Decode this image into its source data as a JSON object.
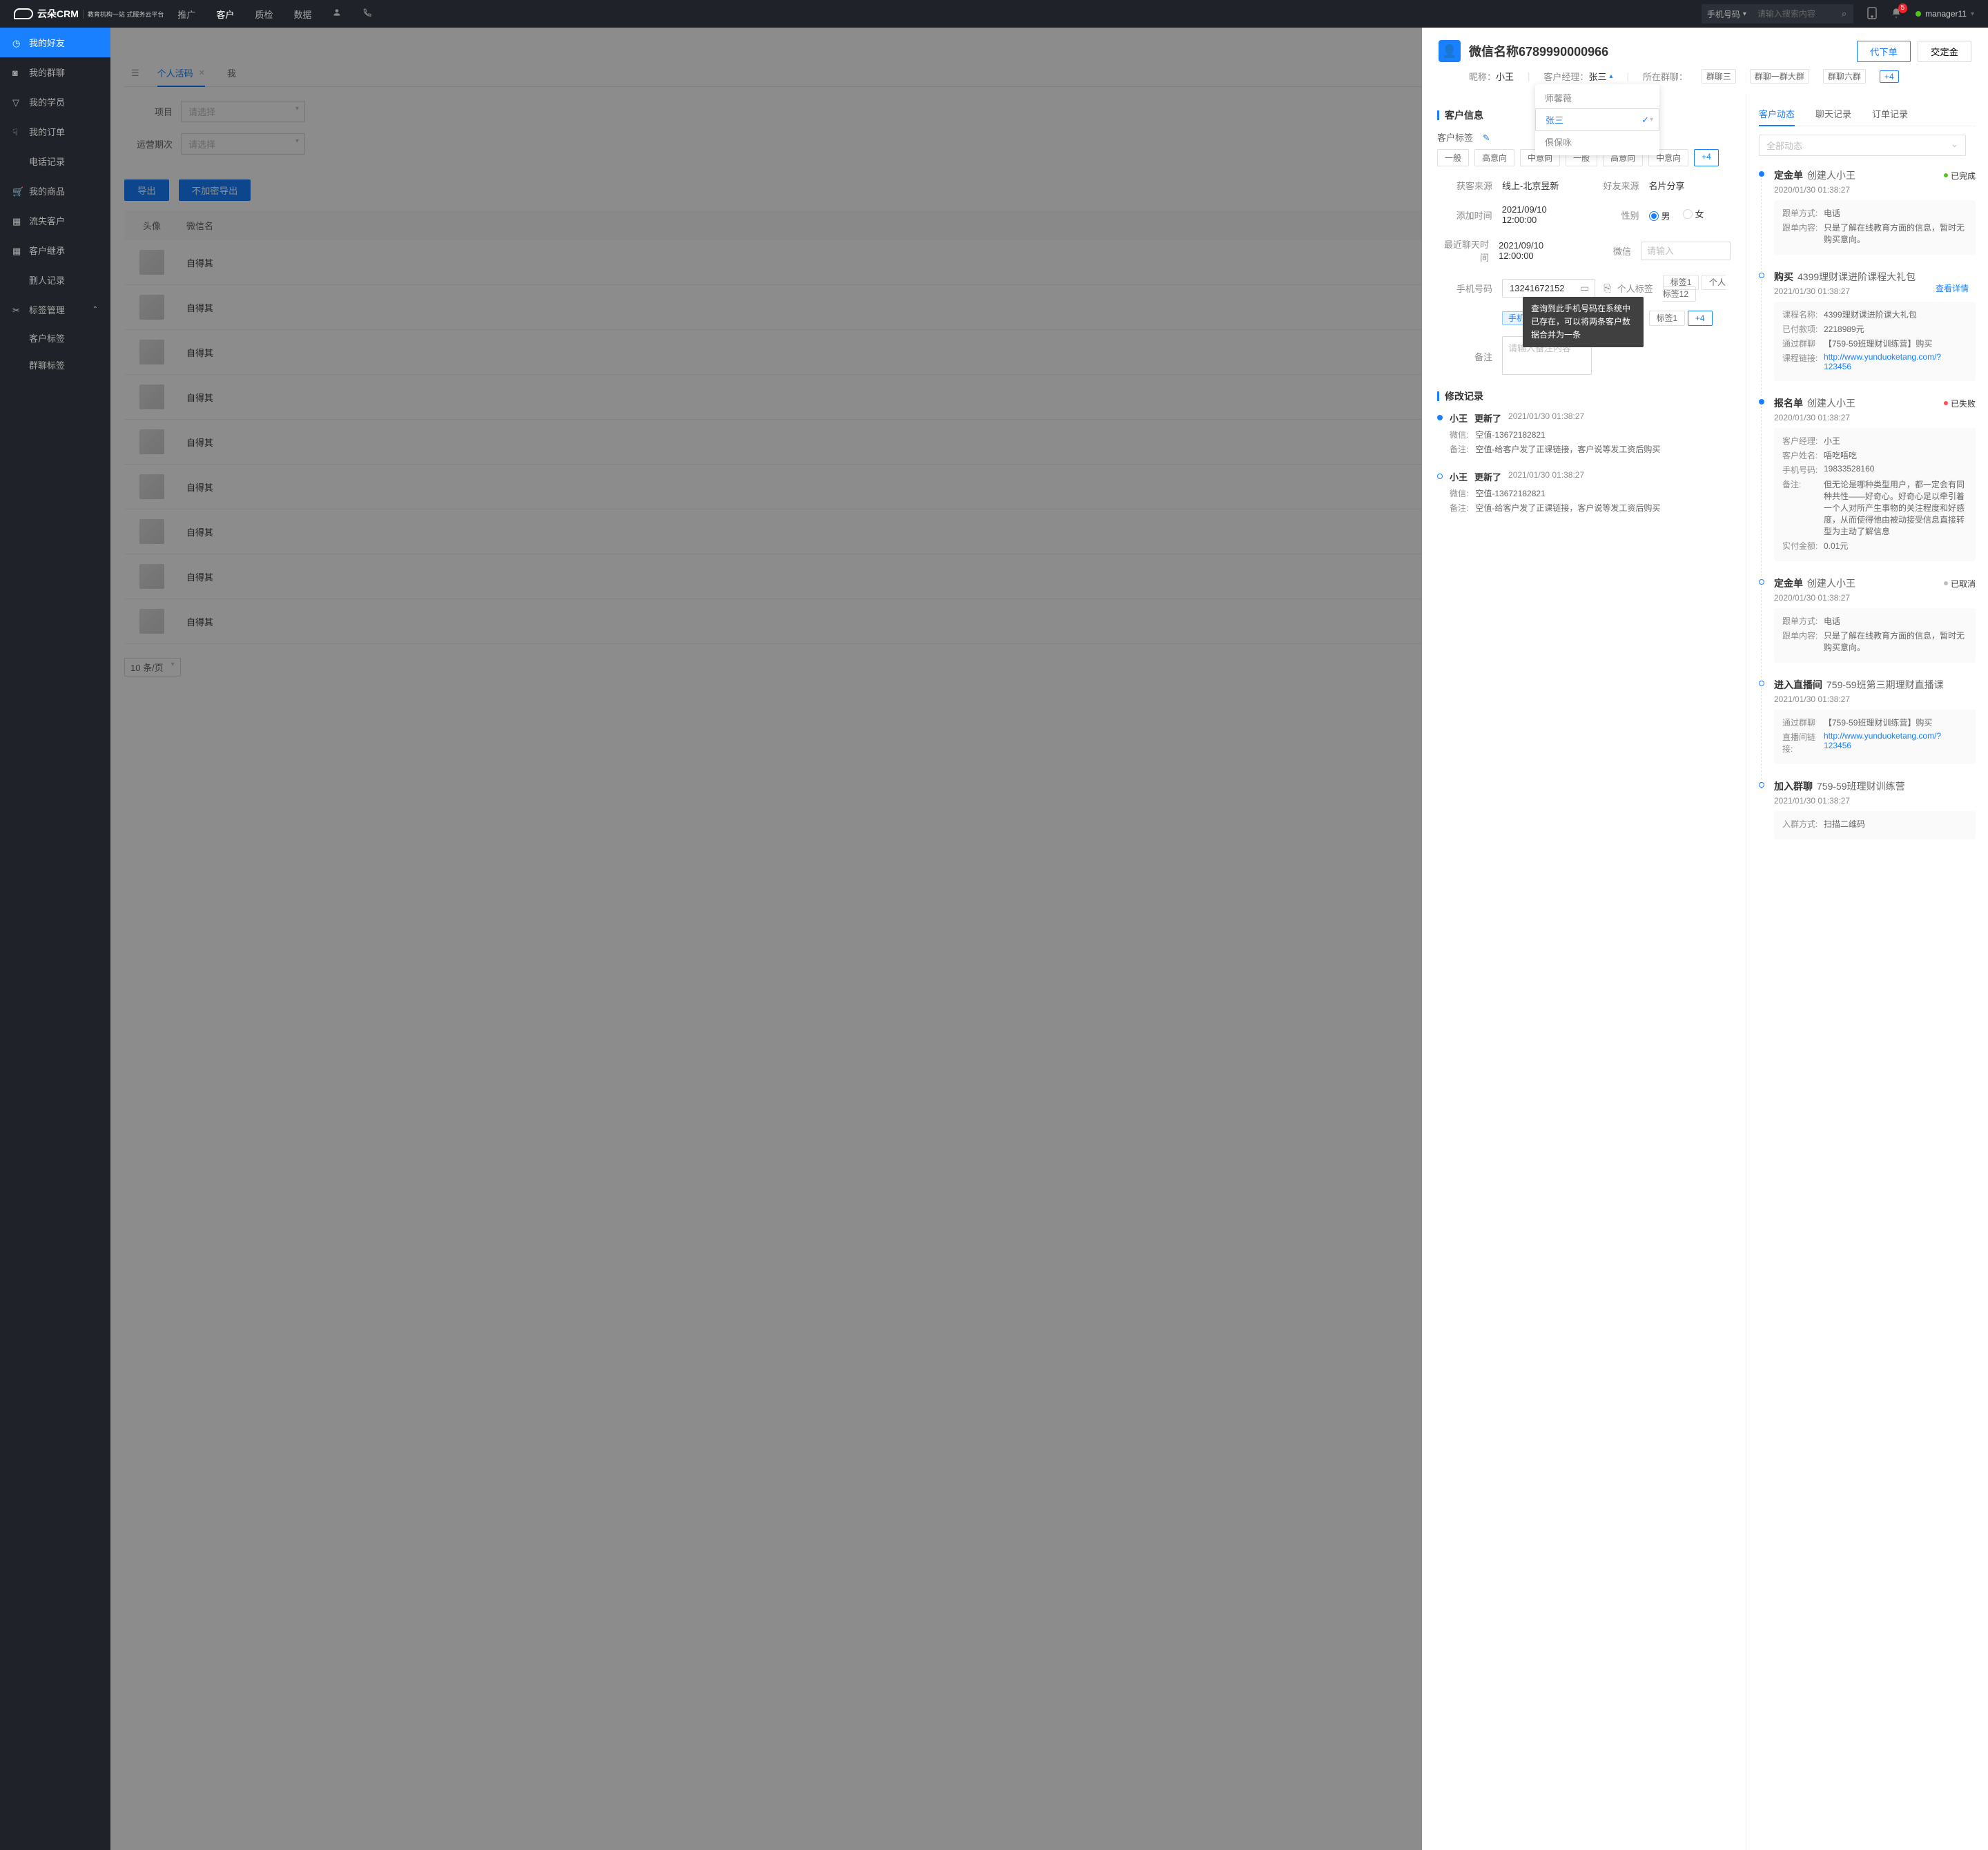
{
  "topbar": {
    "logo": "云朵CRM",
    "logo_sub": "教育机构一站\n式服务云平台",
    "nav": [
      "推广",
      "客户",
      "质检",
      "数据"
    ],
    "nav_active": 1,
    "search_type": "手机号码",
    "search_placeholder": "请输入搜索内容",
    "badge": "5",
    "user": "manager11"
  },
  "sidebar": {
    "items": [
      {
        "label": "我的好友",
        "active": true
      },
      {
        "label": "我的群聊"
      },
      {
        "label": "我的学员"
      },
      {
        "label": "我的订单"
      },
      {
        "label": "电话记录"
      },
      {
        "label": "我的商品"
      },
      {
        "label": "流失客户"
      },
      {
        "label": "客户继承"
      },
      {
        "label": "删人记录"
      },
      {
        "label": "标签管理",
        "expand": true
      }
    ],
    "subs": [
      "客户标签",
      "群聊标签"
    ]
  },
  "tabs": {
    "active": "个人活码",
    "second": "我"
  },
  "filters": {
    "project_label": "项目",
    "period_label": "运营期次",
    "placeholder": "请选择"
  },
  "actions": {
    "export": "导出",
    "export2": "不加密导出"
  },
  "table": {
    "h_avatar": "头像",
    "h_name": "微信名",
    "rows": [
      "自得其",
      "自得其",
      "自得其",
      "自得其",
      "自得其",
      "自得其",
      "自得其",
      "自得其",
      "自得其"
    ]
  },
  "pager": {
    "size": "10 条/页"
  },
  "drawer": {
    "title": "微信名称6789990000966",
    "nickname_label": "昵称：",
    "nickname": "小王",
    "mgr_label": "客户经理：",
    "mgr": "张三",
    "group_label": "所在群聊：",
    "groups": [
      "群聊三",
      "群聊一群大群",
      "群聊六群"
    ],
    "group_more": "+4",
    "btn_order": "代下单",
    "btn_deposit": "交定金",
    "dropdown": [
      "师馨薇",
      "张三",
      "俱保咏"
    ],
    "dd_sel": 1,
    "sec_info": "客户信息",
    "tag_label": "客户标签",
    "tags": [
      "一般",
      "高意向",
      "中意向",
      "一般",
      "高意向",
      "中意向"
    ],
    "tag_more": "+4",
    "info": {
      "source_l": "获客来源",
      "source": "线上-北京昱新",
      "friend_l": "好友来源",
      "friend": "名片分享",
      "add_l": "添加时间",
      "add": "2021/09/10 12:00:00",
      "gender_l": "性别",
      "male": "男",
      "female": "女",
      "chat_l": "最近聊天时间",
      "chat": "2021/09/10 12:00:00",
      "wechat_l": "微信",
      "wechat_ph": "请输入",
      "phone_l": "手机号码",
      "phone": "13241672152",
      "phone_chip": "手机",
      "ptag_l": "个人标签",
      "ptags": [
        "标签1",
        "个人标签12",
        "标签1"
      ],
      "ptag_more": "+4",
      "remark_l": "备注",
      "remark_ph": "请输入备注内容"
    },
    "tooltip": "查询到此手机号码在系统中已存在，可以将两条客户数据合并为一条",
    "sec_mod": "修改记录",
    "mods": [
      {
        "name": "小王",
        "act": "更新了",
        "time": "2021/01/30   01:38:27",
        "lines": [
          [
            "微信:",
            "空值-13672182821"
          ],
          [
            "备注:",
            "空值-给客户发了正课链接，客户说等发工资后购买"
          ]
        ]
      },
      {
        "name": "小王",
        "act": "更新了",
        "time": "2021/01/30   01:38:27",
        "lines": [
          [
            "微信:",
            "空值-13672182821"
          ],
          [
            "备注:",
            "空值-给客户发了正课链接，客户说等发工资后购买"
          ]
        ]
      }
    ]
  },
  "right": {
    "tabs": [
      "客户动态",
      "聊天记录",
      "订单记录"
    ],
    "active": 0,
    "filter": "全部动态",
    "detail": "查看详情",
    "tl": [
      {
        "dot": "fill",
        "title": "定金单",
        "sub": "创建人小王",
        "status": "已完成",
        "sc": "#52c41a",
        "time": "2020/01/30  01:38:27",
        "card": [
          [
            "跟单方式:",
            "电话"
          ],
          [
            "跟单内容:",
            "只是了解在线教育方面的信息，暂时无购买意向。"
          ]
        ]
      },
      {
        "dot": "open",
        "title": "购买",
        "sub": "4399理财课进阶课程大礼包",
        "detail": true,
        "time": "2021/01/30  01:38:27",
        "card": [
          [
            "课程名称:",
            "4399理财课进阶课大礼包"
          ],
          [
            "已付款项:",
            "2218989元"
          ],
          [
            "通过群聊",
            "【759-59班理财训练营】购买"
          ],
          [
            "课程链接:",
            "http://www.yunduoketang.com/?123456"
          ]
        ],
        "link": 3
      },
      {
        "dot": "fill",
        "title": "报名单",
        "sub": "创建人小王",
        "status": "已失败",
        "sc": "#ff4d4f",
        "time": "2020/01/30  01:38:27",
        "card": [
          [
            "客户经理:",
            "小王"
          ],
          [
            "客户姓名:",
            "唔吃唔吃"
          ],
          [
            "手机号码:",
            "19833528160"
          ],
          [
            "备注:",
            "但无论是哪种类型用户，都一定会有同种共性——好奇心。好奇心足以牵引着一个人对所产生事物的关注程度和好感度，从而使得他由被动接受信息直接转型为主动了解信息"
          ],
          [
            "实付金额:",
            "0.01元"
          ]
        ]
      },
      {
        "dot": "open",
        "title": "定金单",
        "sub": "创建人小王",
        "status": "已取消",
        "sc": "#bfbfbf",
        "time": "2020/01/30  01:38:27",
        "card": [
          [
            "跟单方式:",
            "电话"
          ],
          [
            "跟单内容:",
            "只是了解在线教育方面的信息，暂时无购买意向。"
          ]
        ]
      },
      {
        "dot": "open",
        "title": "进入直播间",
        "sub": "759-59班第三期理财直播课",
        "time": "2021/01/30  01:38:27",
        "card": [
          [
            "通过群聊",
            "【759-59班理财训练营】购买"
          ],
          [
            "直播间链接:",
            "http://www.yunduoketang.com/?123456"
          ]
        ],
        "link": 1
      },
      {
        "dot": "open",
        "title": "加入群聊",
        "sub": "759-59班理财训练营",
        "time": "2021/01/30  01:38:27",
        "card": [
          [
            "入群方式:",
            "扫描二维码"
          ]
        ]
      }
    ]
  }
}
